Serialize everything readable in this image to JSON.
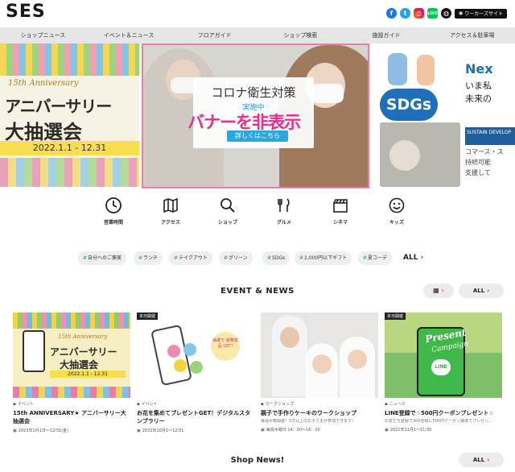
{
  "header": {
    "logo": "SES",
    "social": [
      "facebook-icon",
      "twitter-icon",
      "instagram-icon",
      "line-icon",
      "globe-icon"
    ],
    "worker_site": "ワーカーズサイト",
    "line_label": "LINE"
  },
  "nav": {
    "items": [
      "ショップニュース",
      "イベント＆ニュース",
      "フロアガイド",
      "ショップ検索",
      "施設ガイド",
      "アクセス＆駐車場"
    ]
  },
  "hero": {
    "left": {
      "anniversary_en": "15th Anniversary",
      "anniversary_ja": "アニバーサリー",
      "draw": "大抽選会",
      "dates": "2022.1.1 - 12.31"
    },
    "center": {
      "title": "コロナ衛生対策",
      "subtitle": "実施中",
      "button": "詳しくはこちら",
      "overlay": "バナーを非表示"
    },
    "right": {
      "next": "Nex",
      "line1": "いま私",
      "line2": "未来の",
      "sdgs": "SDGs",
      "band": "SUSTAIN DEVELOP",
      "small1": "コマース・ス",
      "small2": "持続可能",
      "small3": "支援して"
    }
  },
  "categories": [
    {
      "icon": "clock-icon",
      "label": "営業時間"
    },
    {
      "icon": "map-icon",
      "label": "アクセス"
    },
    {
      "icon": "search-icon",
      "label": "ショップ"
    },
    {
      "icon": "fork-knife-icon",
      "label": "グルメ"
    },
    {
      "icon": "clapperboard-icon",
      "label": "シネマ"
    },
    {
      "icon": "smile-icon",
      "label": "キッズ"
    }
  ],
  "tags": {
    "items": [
      "自分へのご褒美",
      "ランチ",
      "テイクアウト",
      "グリーン",
      "SDGs",
      "2,000円以下ギフト",
      "夏コーデ"
    ],
    "all": "ALL"
  },
  "events": {
    "title": "EVENT & NEWS",
    "all": "ALL",
    "cards": [
      {
        "badge": "",
        "category": "イベント",
        "title": "15th ANNIVERSARY★ アニバーサリー大抽選会",
        "desc": "",
        "date": "2023年1月1日〜12/31(金)",
        "img": {
          "t1": "15th Anniversary",
          "t2": "アニバーサリー",
          "t3": "大抽選会",
          "date": "2022.1.1 - 12.31"
        }
      },
      {
        "badge": "本日開催",
        "category": "イベント",
        "title": "お花を集めてプレゼントGET！デジタルスタンプラリー",
        "desc": "",
        "date": "2022年10月1〜12/31",
        "img": {
          "bubble": "抽選で 豪華賞品 GET!"
        }
      },
      {
        "badge": "",
        "category": "ワークショップ",
        "title": "親子で手作りケーキのワークショップ",
        "desc": "毎週木曜開催！5才以上のお子さまが参加できます♪",
        "date": "毎週木曜日 14：00〜16：00",
        "img": {}
      },
      {
        "badge": "本日開催",
        "category": "ニュース",
        "title": "LINE登録で☆500円クーポンプレゼント☆",
        "desc": "お友だち登録で300名様に500円クーポン抽選でプレゼン…",
        "date": "2022年11月1〜11/30",
        "img": {
          "present": "Present",
          "campaign": "Campaign",
          "line": "LINE"
        }
      }
    ]
  },
  "shop_news": {
    "title": "Shop News!",
    "all": "ALL"
  },
  "colors": {
    "accent": "#e2006e",
    "tag_hash": "#2cb58a",
    "covid_button": "#2ba7de",
    "overlay_text": "#ea2d8c"
  }
}
